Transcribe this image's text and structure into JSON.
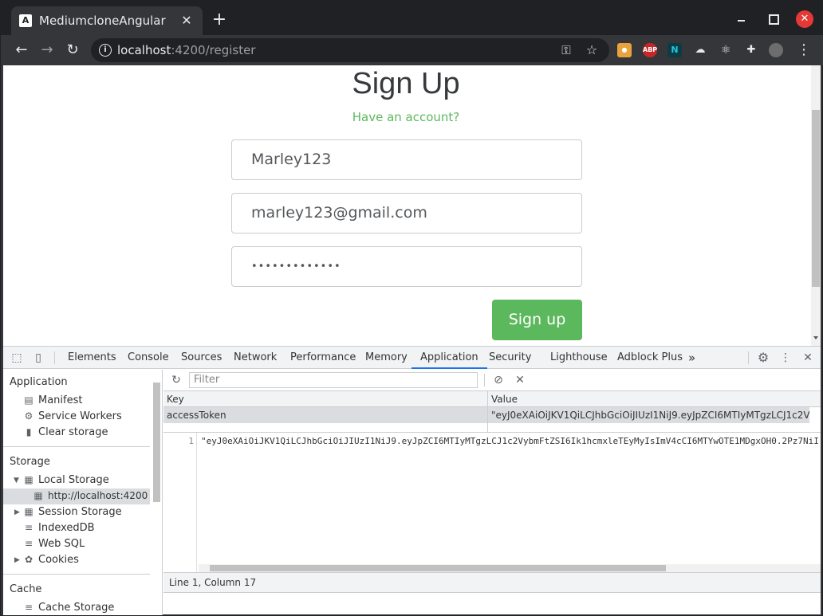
{
  "browser": {
    "tab_title": "MediumcloneAngular",
    "tab_favicon": "A",
    "url_host": "localhost",
    "url_path": ":4200/register"
  },
  "page": {
    "title": "Sign Up",
    "have_account_link": "Have an account?",
    "username_value": "Marley123",
    "email_value": "marley123@gmail.com",
    "password_value": "•••••••••••••",
    "submit_label": "Sign up",
    "accent_color": "#5cb85c"
  },
  "devtools": {
    "tabs": [
      "Elements",
      "Console",
      "Sources",
      "Network",
      "Performance",
      "Memory",
      "Application",
      "Security",
      "Lighthouse",
      "Adblock Plus"
    ],
    "active_tab": "Application",
    "more_tabs": "»",
    "sidebar": {
      "application_heading": "Application",
      "manifest": "Manifest",
      "service_workers": "Service Workers",
      "clear_storage": "Clear storage",
      "storage_heading": "Storage",
      "local_storage": "Local Storage",
      "local_origin": "http://localhost:4200",
      "session_storage": "Session Storage",
      "indexeddb": "IndexedDB",
      "web_sql": "Web SQL",
      "cookies": "Cookies",
      "cache_heading": "Cache",
      "cache_storage": "Cache Storage"
    },
    "filter_placeholder": "Filter",
    "table": {
      "key_header": "Key",
      "value_header": "Value",
      "row_key": "accessToken",
      "row_value": "\"eyJ0eXAiOiJKV1QiLCJhbGciOiJIUzI1NiJ9.eyJpZCI6MTIyMTgzLCJ1c2V..."
    },
    "preview": {
      "line_number": "1",
      "code": "\"eyJ0eXAiOiJKV1QiLCJhbGciOiJIUzI1NiJ9.eyJpZCI6MTIyMTgzLCJ1c2VybmFtZSI6Ik1hcmxleTEyMyIsImV4cCI6MTYwOTE1MDgxOH0.2Pz7NiIl"
    },
    "status": "Line 1, Column 17"
  }
}
